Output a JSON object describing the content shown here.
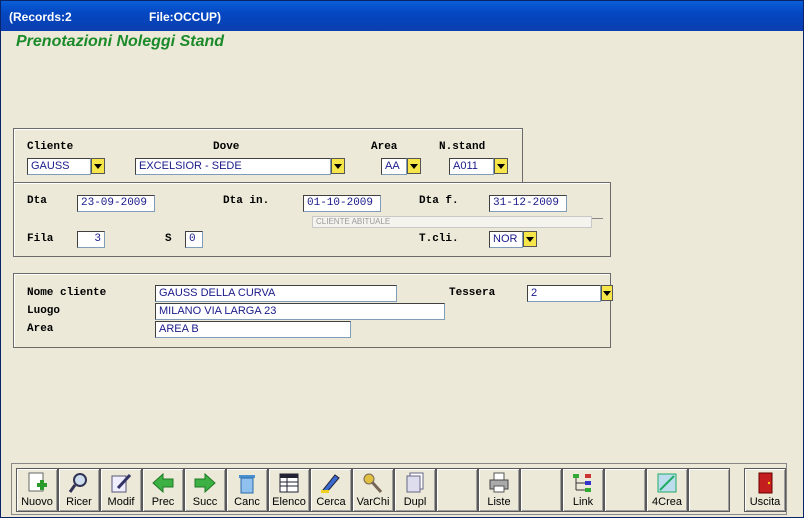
{
  "title": {
    "records": "(Records:2",
    "file": "File:OCCUP)"
  },
  "app_title": "Prenotazioni Noleggi Stand",
  "labels": {
    "cliente": "Cliente",
    "dove": "Dove",
    "area": "Area",
    "nstand": "N.stand",
    "dta": "Dta",
    "dta_in": "Dta in.",
    "dta_f": "Dta f.",
    "fila": "Fila",
    "s": "S",
    "tcli": "T.cli.",
    "nome_cliente": "Nome cliente",
    "tessera": "Tessera",
    "luogo": "Luogo",
    "area2": "Area"
  },
  "fields": {
    "cliente": "GAUSS",
    "dove": "EXCELSIOR - SEDE",
    "area": "AA",
    "nstand": "A011",
    "dta": "23-09-2009",
    "dta_in": "01-10-2009",
    "dta_f": "31-12-2009",
    "hint": "CLIENTE ABITUALE",
    "fila": "3",
    "s": "0",
    "tcli": "NOR",
    "nome_cliente": "GAUSS DELLA CURVA",
    "tessera": "2",
    "luogo": "MILANO VIA LARGA 23",
    "area2": "AREA B"
  },
  "toolbar": [
    "Nuovo",
    "Ricer",
    "Modif",
    "Prec",
    "Succ",
    "Canc",
    "Elenco",
    "Cerca",
    "VarChi",
    "Dupl",
    "",
    "Liste",
    "",
    "Link",
    "",
    "4Crea",
    "",
    "Uscita"
  ]
}
